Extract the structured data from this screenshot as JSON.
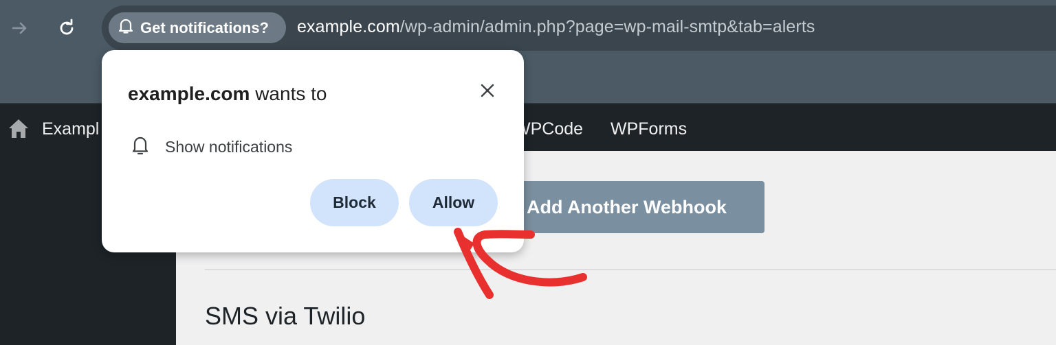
{
  "browser": {
    "notification_chip": "Get notifications?",
    "url_host": "example.com",
    "url_path": "/wp-admin/admin.php?page=wp-mail-smtp&tab=alerts"
  },
  "adminbar": {
    "site_name": "Exampl",
    "menu_items": [
      "WPCode",
      "WPForms"
    ]
  },
  "content": {
    "add_webhook_button": "Add Another Webhook",
    "section_title": "SMS via Twilio"
  },
  "popup": {
    "title_host": "example.com",
    "title_rest": " wants to",
    "permission": "Show notifications",
    "block_label": "Block",
    "allow_label": "Allow"
  },
  "colors": {
    "chrome": "#4b5a65",
    "adminbar": "#1d2327",
    "pill": "#d2e3fc",
    "annotation": "#e8302f"
  }
}
